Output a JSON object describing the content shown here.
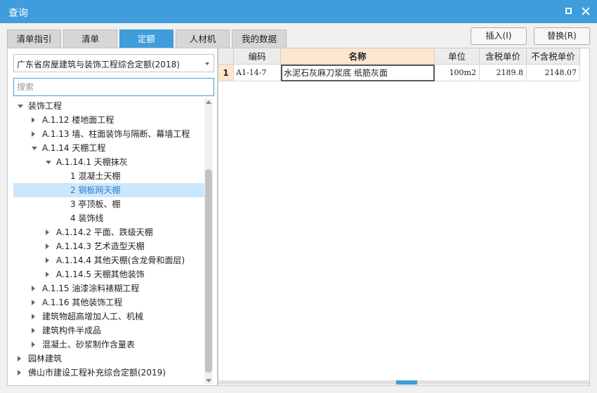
{
  "window": {
    "title": "查询"
  },
  "tabs": [
    {
      "label": "清单指引",
      "active": false
    },
    {
      "label": "清单",
      "active": false
    },
    {
      "label": "定额",
      "active": true
    },
    {
      "label": "人材机",
      "active": false
    },
    {
      "label": "我的数据",
      "active": false
    }
  ],
  "buttons": {
    "insert": "插入(I)",
    "replace": "替换(R)"
  },
  "left": {
    "dropdown_value": "广东省房屋建筑与装饰工程综合定额(2018)",
    "search_placeholder": "搜索"
  },
  "tree": [
    {
      "label": "装饰工程",
      "level": 0,
      "expander": "down"
    },
    {
      "label": "A.1.12 楼地面工程",
      "level": 1,
      "expander": "right"
    },
    {
      "label": "A.1.13 墙、柱面装饰与隔断、幕墙工程",
      "level": 1,
      "expander": "right"
    },
    {
      "label": "A.1.14 天棚工程",
      "level": 1,
      "expander": "down"
    },
    {
      "label": "A.1.14.1 天棚抹灰",
      "level": 2,
      "expander": "down"
    },
    {
      "label": "1 混凝土天棚",
      "level": 3,
      "expander": "none"
    },
    {
      "label": "2 钢板网天棚",
      "level": 3,
      "expander": "none",
      "selected": true
    },
    {
      "label": "3 亭顶板、棚",
      "level": 3,
      "expander": "none"
    },
    {
      "label": "4 装饰线",
      "level": 3,
      "expander": "none"
    },
    {
      "label": "A.1.14.2 平面、跌级天棚",
      "level": 2,
      "expander": "right"
    },
    {
      "label": "A.1.14.3 艺术造型天棚",
      "level": 2,
      "expander": "right"
    },
    {
      "label": "A.1.14.4 其他天棚(含龙骨和面层)",
      "level": 2,
      "expander": "right"
    },
    {
      "label": "A.1.14.5 天棚其他装饰",
      "level": 2,
      "expander": "right"
    },
    {
      "label": "A.1.15 油漆涂料裱糊工程",
      "level": 1,
      "expander": "right"
    },
    {
      "label": "A.1.16 其他装饰工程",
      "level": 1,
      "expander": "right"
    },
    {
      "label": "建筑物超高增加人工、机械",
      "level": 1,
      "expander": "right"
    },
    {
      "label": "建筑构件半成品",
      "level": 1,
      "expander": "right"
    },
    {
      "label": "混凝土、砂浆制作含量表",
      "level": 1,
      "expander": "right"
    },
    {
      "label": "园林建筑",
      "level": 0,
      "expander": "right"
    },
    {
      "label": "佛山市建设工程补充综合定额(2019)",
      "level": 0,
      "expander": "right"
    }
  ],
  "table": {
    "headers": [
      "编码",
      "名称",
      "单位",
      "含税单价",
      "不含税单价"
    ],
    "rows": [
      {
        "num": "1",
        "code": "A1-14-7",
        "name": "水泥石灰麻刀浆底 纸筋灰面",
        "unit": "100m2",
        "price_tax": "2189.8",
        "price_notax": "2148.07"
      }
    ]
  },
  "colors": {
    "accent": "#3f9ddb",
    "header_highlight": "#fde5cf",
    "selected_row": "#cce6fb"
  }
}
